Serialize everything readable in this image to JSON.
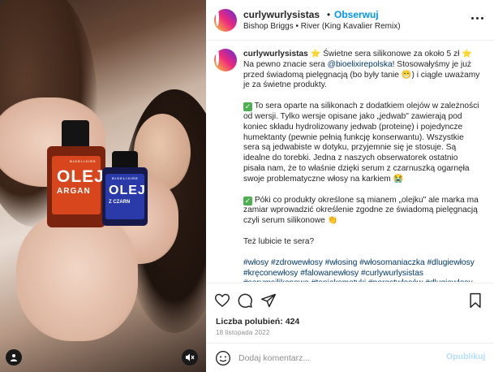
{
  "post": {
    "username": "curlywurlysistas",
    "separator": "•",
    "follow_label": "Obserwuj",
    "music": "Bishop Briggs • River (King Kavalier Remix)"
  },
  "media": {
    "bottle_large": {
      "brand": "BIOELIXIRE",
      "word": "OLEJ",
      "sub": "ARGAN"
    },
    "bottle_small": {
      "brand": "BIOELIXIRE",
      "word": "OLEJ",
      "sub": "Z CZARN"
    },
    "overlay_icons": [
      "user-tag-icon",
      "audio-muted-icon"
    ]
  },
  "caption": {
    "username": "curlywurlysistas",
    "p1_a": " ⭐ Świetne sera silikonowe za około 5 zł ⭐ Na pewno znacie sera ",
    "p1_mention": "@bioelixirepolska",
    "p1_b": "! Stosowałyśmy je już przed świadomą pielęgnacją (bo były tanie 😁) i ciągle uważamy je za świetne produkty.",
    "p2": " To sera oparte na silikonach z dodatkiem olejów w zależności od wersji. Tylko wersje opisane jako „jedwab\" zawierają pod koniec składu hydrolizowany jedwab (proteinę) i pojedyncze humektanty (pewnie pełnią funkcję konserwantu). Wszystkie sera są jedwabiste w dotyku, przyjemnie się je stosuje. Są idealne do torebki. Jedna z naszych obserwatorek ostatnio pisała nam, że to właśnie dzięki serum z czarnuszką ogarnęła swoje problematyczne włosy na karkiem 😭",
    "p3": " Póki co produkty określone są mianem „olejku\" ale marka ma zamiar wprowadzić określenie zgodne ze świadomą pielęgnacją czyli serum silikonowe 👏",
    "p4": "Też lubicie te sera?",
    "tags": "#włosy #zdrowewłosy #włosing #włosomaniaczka #dlugiewłosy #kręconewłosy #falowanewłosy #curlywurlysistas #serumsilikonowe #tanieksmetyki #porostwłosów #dlugiewłosy"
  },
  "actions": {
    "icons": [
      "heart-icon",
      "comment-icon",
      "share-icon",
      "bookmark-icon"
    ],
    "likes_label": "Liczba polubień: 424",
    "date": "18 listopada 2022"
  },
  "composer": {
    "placeholder": "Dodaj komentarz...",
    "publish_label": "Opublikuj"
  },
  "colors": {
    "link_blue": "#0095f6",
    "mention_blue": "#00376b",
    "publish_disabled": "#b2dffc",
    "muted_text": "#8e8e8e"
  }
}
